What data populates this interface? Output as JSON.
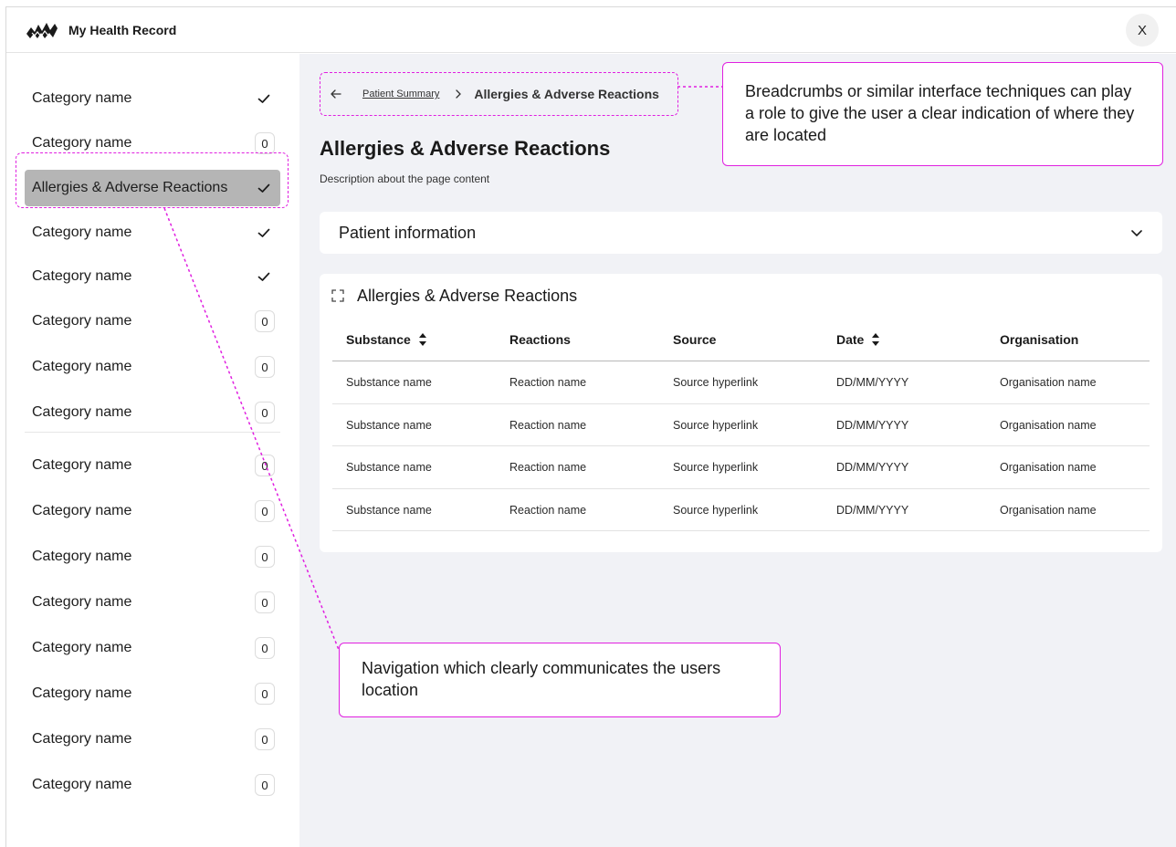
{
  "app": {
    "title": "My Health Record",
    "close_label": "X"
  },
  "sidebar": {
    "items": [
      {
        "label": "Category name",
        "status": "check"
      },
      {
        "label": "Category name",
        "status": "count",
        "count": "0"
      },
      {
        "label": "Allergies & Adverse Reactions",
        "status": "check",
        "active": true
      },
      {
        "label": "Category name",
        "status": "check"
      },
      {
        "label": "Category name",
        "status": "check"
      },
      {
        "label": "Category name",
        "status": "count",
        "count": "0"
      },
      {
        "label": "Category name",
        "status": "count",
        "count": "0"
      },
      {
        "label": "Category name",
        "status": "count",
        "count": "0"
      },
      {
        "label": "Category name",
        "status": "count",
        "count": "0"
      },
      {
        "label": "Category name",
        "status": "count",
        "count": "0"
      },
      {
        "label": "Category name",
        "status": "count",
        "count": "0"
      },
      {
        "label": "Category name",
        "status": "count",
        "count": "0"
      },
      {
        "label": "Category name",
        "status": "count",
        "count": "0"
      },
      {
        "label": "Category name",
        "status": "count",
        "count": "0"
      },
      {
        "label": "Category name",
        "status": "count",
        "count": "0"
      },
      {
        "label": "Category name",
        "status": "count",
        "count": "0"
      }
    ]
  },
  "breadcrumb": {
    "parent": "Patient Summary",
    "current": "Allergies & Adverse Reactions"
  },
  "page": {
    "title": "Allergies & Adverse Reactions",
    "description": "Description about the page content"
  },
  "patient_card": {
    "title": "Patient information"
  },
  "allergy_card": {
    "title": "Allergies & Adverse Reactions",
    "columns": [
      "Substance",
      "Reactions",
      "Source",
      "Date",
      "Organisation"
    ],
    "rows": [
      [
        "Substance name",
        "Reaction name",
        "Source hyperlink",
        "DD/MM/YYYY",
        "Organisation name"
      ],
      [
        "Substance name",
        "Reaction name",
        "Source hyperlink",
        "DD/MM/YYYY",
        "Organisation name"
      ],
      [
        "Substance name",
        "Reaction name",
        "Source hyperlink",
        "DD/MM/YYYY",
        "Organisation name"
      ],
      [
        "Substance name",
        "Reaction name",
        "Source hyperlink",
        "DD/MM/YYYY",
        "Organisation name"
      ]
    ]
  },
  "annotations": {
    "breadcrumb_note": "Breadcrumbs or similar interface techniques can play a role to give the user a clear indication of where they are located",
    "navigation_note": "Navigation which clearly communicates the users location"
  },
  "colors": {
    "annotation": "#e020e0",
    "active_nav": "#b5b5b5",
    "main_bg": "#f1f2f6"
  }
}
